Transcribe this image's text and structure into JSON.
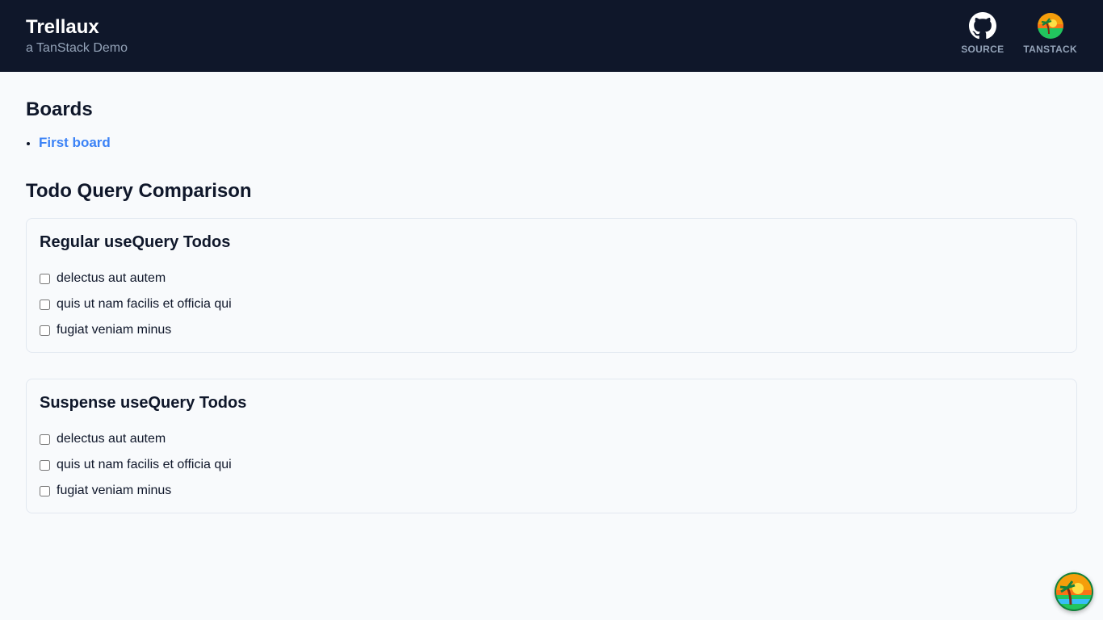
{
  "header": {
    "title": "Trellaux",
    "subtitle": "a TanStack Demo",
    "links": [
      {
        "label": "SOURCE",
        "icon": "github-icon"
      },
      {
        "label": "TANSTACK",
        "icon": "tanstack-logo-icon"
      }
    ]
  },
  "boards": {
    "title": "Boards",
    "items": [
      {
        "label": "First board"
      }
    ]
  },
  "comparison": {
    "title": "Todo Query Comparison",
    "cards": [
      {
        "title": "Regular useQuery Todos",
        "todos": [
          {
            "label": "delectus aut autem",
            "checked": false
          },
          {
            "label": "quis ut nam facilis et officia qui",
            "checked": false
          },
          {
            "label": "fugiat veniam minus",
            "checked": false
          }
        ]
      },
      {
        "title": "Suspense useQuery Todos",
        "todos": [
          {
            "label": "delectus aut autem",
            "checked": false
          },
          {
            "label": "quis ut nam facilis et officia qui",
            "checked": false
          },
          {
            "label": "fugiat veniam minus",
            "checked": false
          }
        ]
      }
    ]
  },
  "colors": {
    "header_bg": "#0f172a",
    "link": "#3b82f6",
    "muted": "#94a3b8"
  }
}
